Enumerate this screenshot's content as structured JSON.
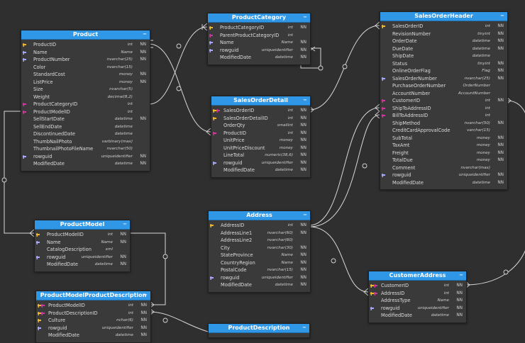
{
  "colors": {
    "background": "#2f2f2f",
    "entity_bg": "#3a3a3a",
    "header": "#2f97e6",
    "link": "#d8d8d8",
    "pk_key": "#f0b72e",
    "fk_key": "#d0379a",
    "unique_key": "#a9a9ff"
  },
  "collapse_icon": "minus-icon",
  "entities": [
    {
      "id": "product",
      "title": "Product",
      "columns": [
        {
          "name": "ProductID",
          "type": "int",
          "nn": "NN",
          "key": "pk"
        },
        {
          "name": "Name",
          "type": "Name",
          "nn": "NN",
          "key": "uk"
        },
        {
          "name": "ProductNumber",
          "type": "nvarchar(25)",
          "nn": "NN",
          "key": "uk"
        },
        {
          "name": "Color",
          "type": "nvarchar(15)",
          "nn": "",
          "key": ""
        },
        {
          "name": "StandardCost",
          "type": "money",
          "nn": "NN",
          "key": ""
        },
        {
          "name": "ListPrice",
          "type": "money",
          "nn": "NN",
          "key": ""
        },
        {
          "name": "Size",
          "type": "nvarchar(5)",
          "nn": "",
          "key": ""
        },
        {
          "name": "Weight",
          "type": "decimal(8,2)",
          "nn": "",
          "key": ""
        },
        {
          "name": "ProductCategoryID",
          "type": "int",
          "nn": "",
          "key": "fk"
        },
        {
          "name": "ProductModelID",
          "type": "int",
          "nn": "",
          "key": "fk"
        },
        {
          "name": "SellStartDate",
          "type": "datetime",
          "nn": "NN",
          "key": ""
        },
        {
          "name": "SellEndDate",
          "type": "datetime",
          "nn": "",
          "key": ""
        },
        {
          "name": "DiscontinuedDate",
          "type": "datetime",
          "nn": "",
          "key": ""
        },
        {
          "name": "ThumbNailPhoto",
          "type": "varbinary(max)",
          "nn": "",
          "key": ""
        },
        {
          "name": "ThumbnailPhotoFileName",
          "type": "nvarchar(50)",
          "nn": "",
          "key": ""
        },
        {
          "name": "rowguid",
          "type": "uniqueidentifier",
          "nn": "NN",
          "key": "uk"
        },
        {
          "name": "ModifiedDate",
          "type": "datetime",
          "nn": "NN",
          "key": ""
        }
      ]
    },
    {
      "id": "productcategory",
      "title": "ProductCategory",
      "columns": [
        {
          "name": "ProductCategoryID",
          "type": "int",
          "nn": "NN",
          "key": "pk"
        },
        {
          "name": "ParentProductCategoryID",
          "type": "int",
          "nn": "",
          "key": "fk"
        },
        {
          "name": "Name",
          "type": "Name",
          "nn": "NN",
          "key": "uk"
        },
        {
          "name": "rowguid",
          "type": "uniqueidentifier",
          "nn": "NN",
          "key": "uk"
        },
        {
          "name": "ModifiedDate",
          "type": "datetime",
          "nn": "NN",
          "key": ""
        }
      ]
    },
    {
      "id": "salesorderdetail",
      "title": "SalesOrderDetail",
      "columns": [
        {
          "name": "SalesOrderID",
          "type": "int",
          "nn": "NN",
          "key": "pkfk"
        },
        {
          "name": "SalesOrderDetailID",
          "type": "int",
          "nn": "NN",
          "key": "pk"
        },
        {
          "name": "OrderQty",
          "type": "smallint",
          "nn": "NN",
          "key": ""
        },
        {
          "name": "ProductID",
          "type": "int",
          "nn": "NN",
          "key": "fk"
        },
        {
          "name": "UnitPrice",
          "type": "money",
          "nn": "NN",
          "key": ""
        },
        {
          "name": "UnitPriceDiscount",
          "type": "money",
          "nn": "NN",
          "key": ""
        },
        {
          "name": "LineTotal",
          "type": "numeric(38,6)",
          "nn": "NN",
          "key": ""
        },
        {
          "name": "rowguid",
          "type": "uniqueidentifier",
          "nn": "NN",
          "key": "uk"
        },
        {
          "name": "ModifiedDate",
          "type": "datetime",
          "nn": "NN",
          "key": ""
        }
      ]
    },
    {
      "id": "salesorderheader",
      "title": "SalesOrderHeader",
      "columns": [
        {
          "name": "SalesOrderID",
          "type": "int",
          "nn": "NN",
          "key": "pk"
        },
        {
          "name": "RevisionNumber",
          "type": "tinyint",
          "nn": "NN",
          "key": ""
        },
        {
          "name": "OrderDate",
          "type": "datetime",
          "nn": "NN",
          "key": ""
        },
        {
          "name": "DueDate",
          "type": "datetime",
          "nn": "NN",
          "key": ""
        },
        {
          "name": "ShipDate",
          "type": "datetime",
          "nn": "",
          "key": ""
        },
        {
          "name": "Status",
          "type": "tinyint",
          "nn": "NN",
          "key": ""
        },
        {
          "name": "OnlineOrderFlag",
          "type": "Flag",
          "nn": "NN",
          "key": ""
        },
        {
          "name": "SalesOrderNumber",
          "type": "nvarchar(25)",
          "nn": "NN",
          "key": "uk"
        },
        {
          "name": "PurchaseOrderNumber",
          "type": "OrderNumber",
          "nn": "",
          "key": ""
        },
        {
          "name": "AccountNumber",
          "type": "AccountNumber",
          "nn": "",
          "key": ""
        },
        {
          "name": "CustomerID",
          "type": "int",
          "nn": "NN",
          "key": "fk"
        },
        {
          "name": "ShipToAddressID",
          "type": "int",
          "nn": "",
          "key": "fk"
        },
        {
          "name": "BillToAddressID",
          "type": "int",
          "nn": "",
          "key": "fk"
        },
        {
          "name": "ShipMethod",
          "type": "nvarchar(50)",
          "nn": "NN",
          "key": ""
        },
        {
          "name": "CreditCardApprovalCode",
          "type": "varchar(15)",
          "nn": "",
          "key": ""
        },
        {
          "name": "SubTotal",
          "type": "money",
          "nn": "NN",
          "key": ""
        },
        {
          "name": "TaxAmt",
          "type": "money",
          "nn": "NN",
          "key": ""
        },
        {
          "name": "Freight",
          "type": "money",
          "nn": "NN",
          "key": ""
        },
        {
          "name": "TotalDue",
          "type": "money",
          "nn": "NN",
          "key": ""
        },
        {
          "name": "Comment",
          "type": "nvarchar(max)",
          "nn": "",
          "key": ""
        },
        {
          "name": "rowguid",
          "type": "uniqueidentifier",
          "nn": "NN",
          "key": "uk"
        },
        {
          "name": "ModifiedDate",
          "type": "datetime",
          "nn": "NN",
          "key": ""
        }
      ]
    },
    {
      "id": "productmodel",
      "title": "ProductModel",
      "columns": [
        {
          "name": "ProductModelID",
          "type": "int",
          "nn": "NN",
          "key": "pk"
        },
        {
          "name": "Name",
          "type": "Name",
          "nn": "NN",
          "key": "uk"
        },
        {
          "name": "CatalogDescription",
          "type": "xml",
          "nn": "",
          "key": ""
        },
        {
          "name": "rowguid",
          "type": "uniqueidentifier",
          "nn": "NN",
          "key": "uk"
        },
        {
          "name": "ModifiedDate",
          "type": "datetime",
          "nn": "NN",
          "key": ""
        }
      ]
    },
    {
      "id": "address",
      "title": "Address",
      "columns": [
        {
          "name": "AddressID",
          "type": "int",
          "nn": "NN",
          "key": "pk"
        },
        {
          "name": "AddressLine1",
          "type": "nvarchar(60)",
          "nn": "NN",
          "key": ""
        },
        {
          "name": "AddressLine2",
          "type": "nvarchar(60)",
          "nn": "",
          "key": ""
        },
        {
          "name": "City",
          "type": "nvarchar(30)",
          "nn": "NN",
          "key": ""
        },
        {
          "name": "StateProvince",
          "type": "Name",
          "nn": "NN",
          "key": ""
        },
        {
          "name": "CountryRegion",
          "type": "Name",
          "nn": "NN",
          "key": ""
        },
        {
          "name": "PostalCode",
          "type": "nvarchar(15)",
          "nn": "NN",
          "key": ""
        },
        {
          "name": "rowguid",
          "type": "uniqueidentifier",
          "nn": "NN",
          "key": "uk"
        },
        {
          "name": "ModifiedDate",
          "type": "datetime",
          "nn": "NN",
          "key": ""
        }
      ]
    },
    {
      "id": "customeraddress",
      "title": "CustomerAddress",
      "columns": [
        {
          "name": "CustomerID",
          "type": "int",
          "nn": "NN",
          "key": "pkfk"
        },
        {
          "name": "AddressID",
          "type": "int",
          "nn": "NN",
          "key": "pkfk"
        },
        {
          "name": "AddressType",
          "type": "Name",
          "nn": "NN",
          "key": ""
        },
        {
          "name": "rowguid",
          "type": "uniqueidentifier",
          "nn": "NN",
          "key": "uk"
        },
        {
          "name": "ModifiedDate",
          "type": "datetime",
          "nn": "NN",
          "key": ""
        }
      ]
    },
    {
      "id": "productmodelproductdescription",
      "title": "ProductModelProductDescription",
      "columns": [
        {
          "name": "ProductModelID",
          "type": "int",
          "nn": "NN",
          "key": "pkfk"
        },
        {
          "name": "ProductDescriptionID",
          "type": "int",
          "nn": "NN",
          "key": "pkfk"
        },
        {
          "name": "Culture",
          "type": "nchar(6)",
          "nn": "NN",
          "key": "pk"
        },
        {
          "name": "rowguid",
          "type": "uniqueidentifier",
          "nn": "NN",
          "key": "uk"
        },
        {
          "name": "ModifiedDate",
          "type": "datetime",
          "nn": "NN",
          "key": ""
        }
      ]
    },
    {
      "id": "productdescription",
      "title": "ProductDescription",
      "columns": []
    }
  ]
}
